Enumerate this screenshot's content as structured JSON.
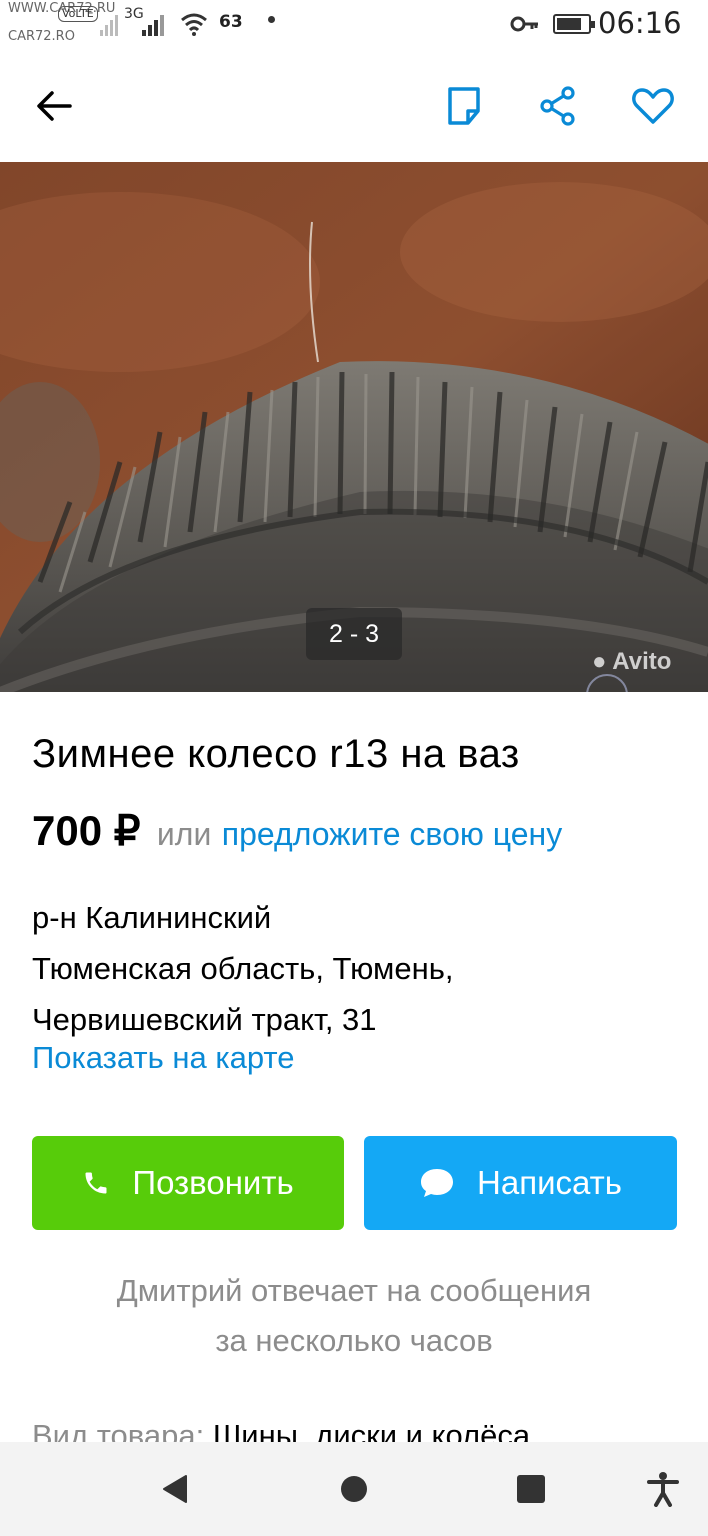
{
  "status_bar": {
    "watermark_top": "WWW.CAR72.RU",
    "watermark_bottom": "CAR72.RO",
    "volte": "VoLTE",
    "network": "3G",
    "notification_count": "63",
    "time": "06:16"
  },
  "header": {
    "back_icon": "arrow-left-icon",
    "note_icon": "note-icon",
    "share_icon": "share-icon",
    "favorite_icon": "heart-icon"
  },
  "photo": {
    "counter": "2 - 3",
    "watermark": "Avito"
  },
  "listing": {
    "title": "Зимнее колесо r13 на ваз",
    "price": "700 ₽",
    "price_or": "или",
    "price_offer": "предложите свою цену",
    "address_lines": [
      "р-н Калининский",
      "Тюменская область, Тюмень,",
      "Червишевский тракт, 31"
    ],
    "map_link": "Показать на карте"
  },
  "actions": {
    "call_label": "Позвонить",
    "message_label": "Написать",
    "call_color": "#57cc0a",
    "message_color": "#14a8f5"
  },
  "seller_note": {
    "line1": "Дмитрий отвечает на сообщения",
    "line2": "за несколько часов"
  },
  "category": {
    "label": "Вид товара:",
    "value": "Шины, диски и колёса"
  },
  "colors": {
    "link": "#0a8ad6",
    "secondary_text": "#8c8c8c"
  }
}
